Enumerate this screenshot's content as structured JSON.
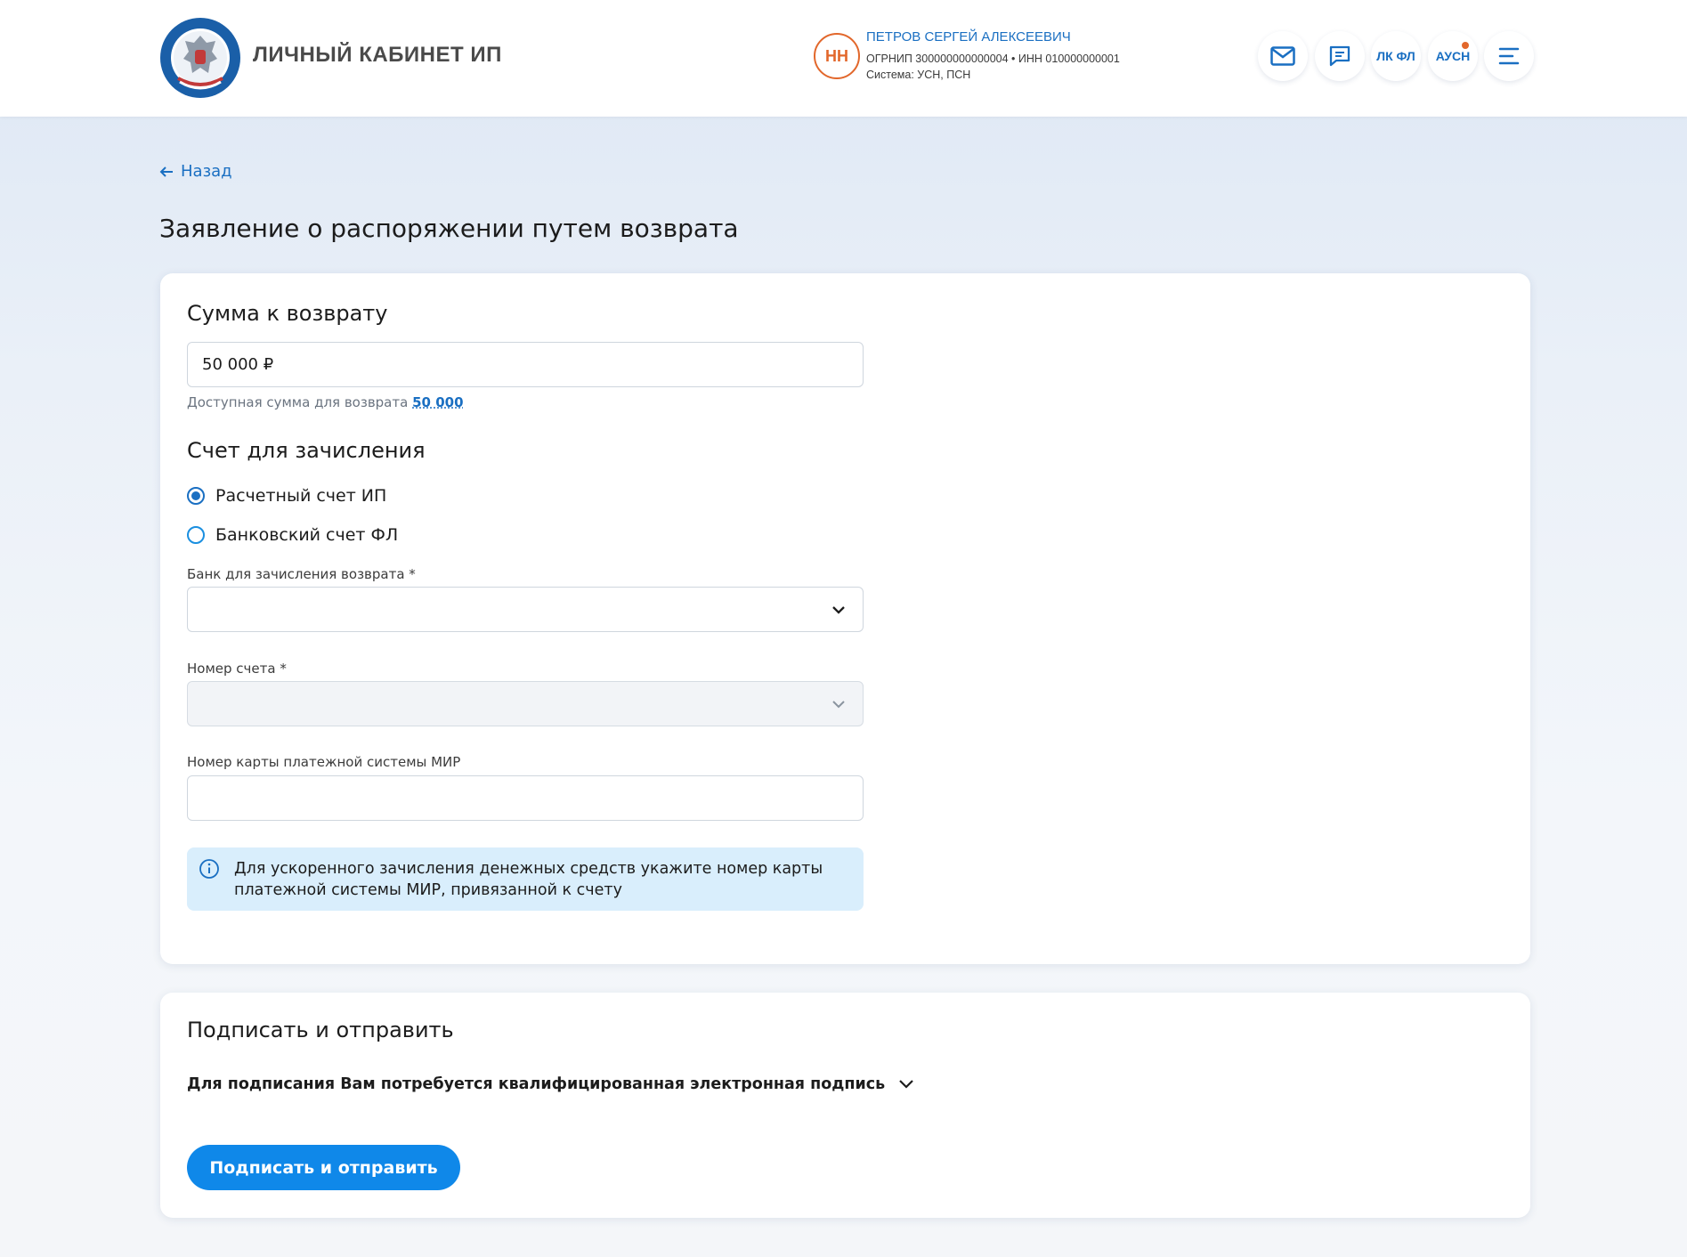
{
  "header": {
    "brand": "ЛИЧНЫЙ КАБИНЕТ ИП",
    "user": {
      "initials": "НН",
      "name": "ПЕТРОВ СЕРГЕЙ АЛЕКСЕЕВИЧ",
      "ids": "ОГРНИП 300000000000004 • ИНН 010000000001",
      "system": "Система: УСН, ПСН"
    },
    "buttons": {
      "mail": "mail-icon",
      "chat": "chat-icon",
      "lk_fl": "ЛК ФЛ",
      "ausn": "АУСН",
      "menu": "menu-icon"
    },
    "colors": {
      "accent": "#1a6fc2",
      "avatar": "#e2672b",
      "notify": "#e2672b"
    }
  },
  "nav": {
    "back": "Назад"
  },
  "page": {
    "title": "Заявление о распоряжении путем возврата"
  },
  "refund": {
    "title": "Сумма к возврату",
    "amount_value": "50 000 ₽",
    "available_label": "Доступная сумма для возврата",
    "available_value": "50 000"
  },
  "account": {
    "title": "Счет для зачисления",
    "options": [
      {
        "label": "Расчетный счет ИП",
        "selected": true
      },
      {
        "label": "Банковский счет ФЛ",
        "selected": false
      }
    ],
    "bank_label": "Банк для зачисления возврата *",
    "bank_value": "",
    "account_label": "Номер счета *",
    "account_value": "",
    "card_label": "Номер карты платежной системы МИР",
    "card_value": "",
    "info_text": "Для ускоренного зачисления денежных средств укажите номер карты платежной системы МИР, привязанной к счету"
  },
  "sign": {
    "title": "Подписать и отправить",
    "requirement": "Для подписания Вам потребуется квалифицированная электронная подпись",
    "button": "Подписать и отправить",
    "button_color": "#0f88e9"
  }
}
